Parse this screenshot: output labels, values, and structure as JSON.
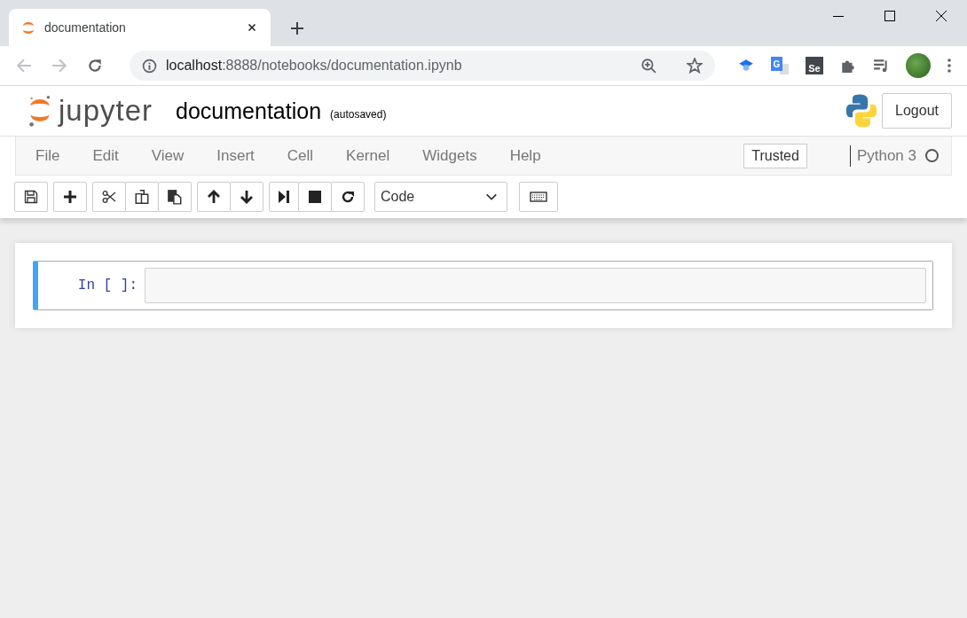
{
  "browser": {
    "tab_title": "documentation",
    "url_host": "localhost",
    "url_path": ":8888/notebooks/documentation.ipynb",
    "translate_badge": "G",
    "selenium_badge": "Se"
  },
  "header": {
    "logo_text": "jupyter",
    "notebook_name": "documentation",
    "save_status": "(autosaved)",
    "logout": "Logout"
  },
  "menubar": {
    "items": [
      "File",
      "Edit",
      "View",
      "Insert",
      "Cell",
      "Kernel",
      "Widgets",
      "Help"
    ],
    "trusted": "Trusted",
    "kernel_name": "Python 3"
  },
  "toolbar": {
    "cell_type": "Code"
  },
  "cells": [
    {
      "prompt": "In [ ]:",
      "selected": true
    }
  ]
}
